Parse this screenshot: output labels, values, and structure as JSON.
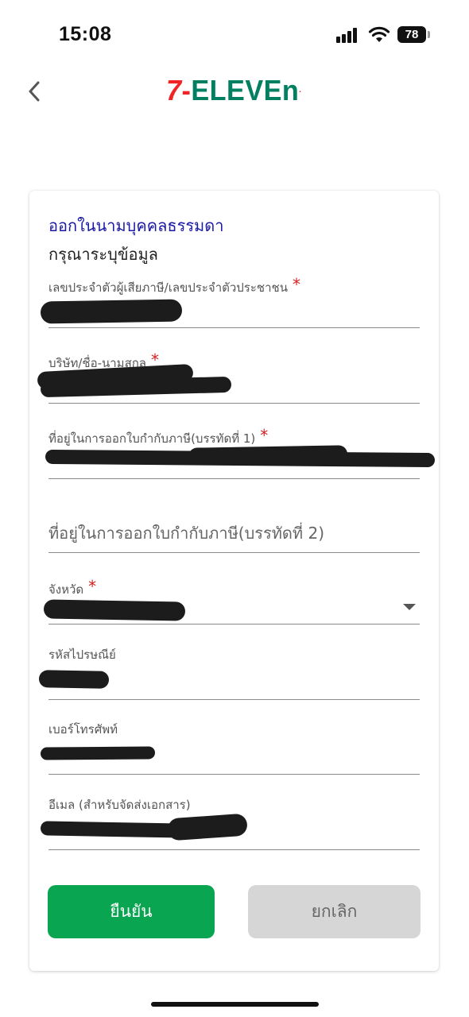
{
  "status_bar": {
    "time": "15:08",
    "battery": "78"
  },
  "header": {
    "logo_seven": "7",
    "logo_dash": "-",
    "logo_word": "ELEVEn",
    "logo_mark": "."
  },
  "form": {
    "title": "ออกในนามบุคคลธรรมดา",
    "subtitle": "กรุณาระบุข้อมูล",
    "required_mark": "*",
    "fields": {
      "tax_id": {
        "label": "เลขประจำตัวผู้เสียภาษี/เลขประจำตัวประชาชน",
        "value": ""
      },
      "name": {
        "label": "บริษัท/ชื่อ-นามสกุล",
        "value": ""
      },
      "address1": {
        "label": "ที่อยู่ในการออกใบกำกับภาษี(บรรทัดที่ 1)",
        "value": ""
      },
      "address2": {
        "placeholder": "ที่อยู่ในการออกใบกำกับภาษี(บรรทัดที่ 2)"
      },
      "province": {
        "label": "จังหวัด",
        "value": ""
      },
      "postal_code": {
        "label": "รหัสไปรษณีย์",
        "value": ""
      },
      "phone": {
        "label": "เบอร์โทรศัพท์",
        "value": ""
      },
      "email": {
        "label": "อีเมล (สำหรับจัดส่งเอกสาร)",
        "value": ""
      }
    },
    "buttons": {
      "confirm": "ยืนยัน",
      "cancel": "ยกเลิก"
    }
  },
  "colors": {
    "accent_green": "#0aa551",
    "title_blue": "#1a1aa6",
    "required_red": "#d32020",
    "brand_red": "#ee2524",
    "brand_green": "#008061",
    "cancel_gray": "#d6d6d6"
  },
  "icons": [
    "signal-icon",
    "wifi-icon",
    "battery-icon",
    "back-chevron-icon",
    "dropdown-arrow-icon"
  ]
}
